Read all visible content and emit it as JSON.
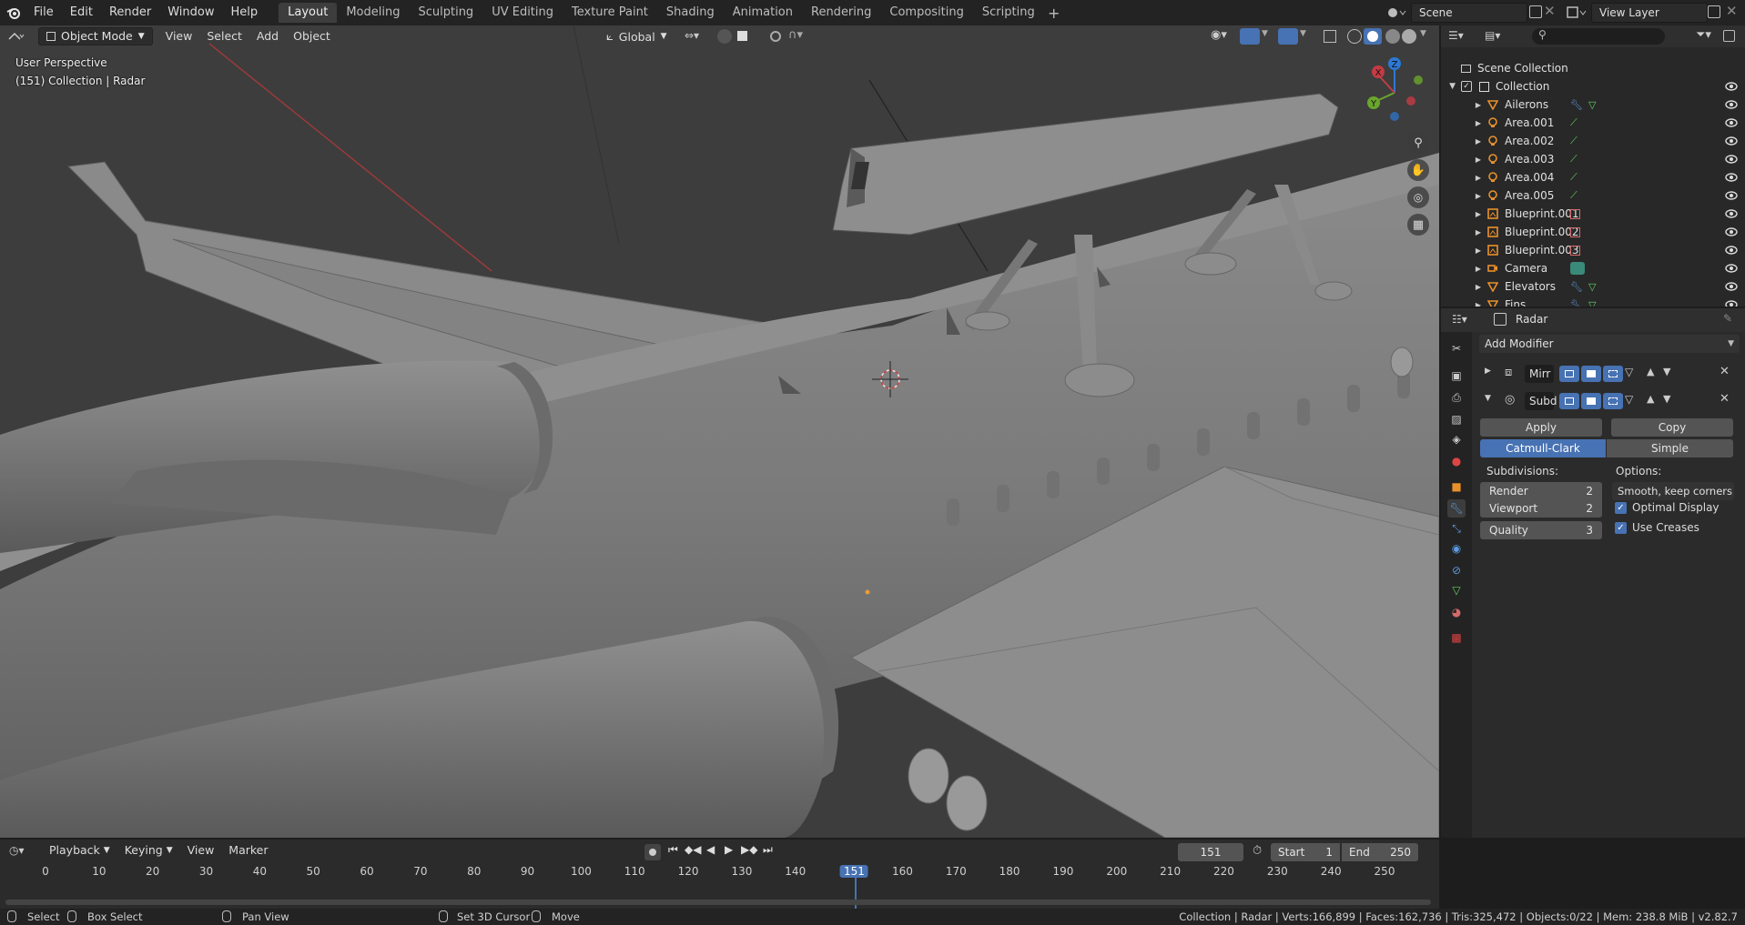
{
  "menubar": {
    "items": [
      "File",
      "Edit",
      "Render",
      "Window",
      "Help"
    ],
    "workspaces": [
      "Layout",
      "Modeling",
      "Sculpting",
      "UV Editing",
      "Texture Paint",
      "Shading",
      "Animation",
      "Rendering",
      "Compositing",
      "Scripting"
    ],
    "active_workspace": "Layout",
    "scene": "Scene",
    "view_layer": "View Layer"
  },
  "viewport": {
    "mode": "Object Mode",
    "menus": [
      "View",
      "Select",
      "Add",
      "Object"
    ],
    "transform_orientation": "Global",
    "info_line1": "User Perspective",
    "info_line2": "(151) Collection | Radar"
  },
  "outliner": {
    "search_placeholder": "",
    "root": "Scene Collection",
    "collection": "Collection",
    "items": [
      {
        "name": "Ailerons",
        "type": "mesh"
      },
      {
        "name": "Area.001",
        "type": "light"
      },
      {
        "name": "Area.002",
        "type": "light"
      },
      {
        "name": "Area.003",
        "type": "light"
      },
      {
        "name": "Area.004",
        "type": "light"
      },
      {
        "name": "Area.005",
        "type": "light"
      },
      {
        "name": "Blueprint.001",
        "type": "image"
      },
      {
        "name": "Blueprint.002",
        "type": "image"
      },
      {
        "name": "Blueprint.003",
        "type": "image"
      },
      {
        "name": "Camera",
        "type": "camera"
      },
      {
        "name": "Elevators",
        "type": "mesh"
      },
      {
        "name": "Fins",
        "type": "mesh"
      }
    ]
  },
  "properties": {
    "object_name": "Radar",
    "add_modifier": "Add Modifier",
    "modifiers": [
      {
        "name": "Mirr",
        "expanded": false
      },
      {
        "name": "Subd",
        "expanded": true
      }
    ],
    "apply_label": "Apply",
    "copy_label": "Copy",
    "catmull_label": "Catmull-Clark",
    "simple_label": "Simple",
    "subdivisions_label": "Subdivisions:",
    "options_label": "Options:",
    "render_label": "Render",
    "render_value": "2",
    "viewport_label": "Viewport",
    "viewport_value": "2",
    "quality_label": "Quality",
    "quality_value": "3",
    "uv_smooth": "Smooth, keep corners",
    "optimal_display": "Optimal Display",
    "use_creases": "Use Creases"
  },
  "timeline": {
    "menus": [
      "Playback",
      "Keying",
      "View",
      "Marker"
    ],
    "current_frame": "151",
    "start_label": "Start",
    "start_value": "1",
    "end_label": "End",
    "end_value": "250",
    "ticks": [
      "0",
      "10",
      "20",
      "30",
      "40",
      "50",
      "60",
      "70",
      "80",
      "90",
      "100",
      "110",
      "120",
      "130",
      "140",
      "151",
      "160",
      "170",
      "180",
      "190",
      "200",
      "210",
      "220",
      "230",
      "240",
      "250"
    ]
  },
  "statusbar": {
    "select": "Select",
    "box_select": "Box Select",
    "pan_view": "Pan View",
    "set_cursor": "Set 3D Cursor",
    "move": "Move",
    "stats": "Collection | Radar | Verts:166,899 | Faces:162,736 | Tris:325,472 | Objects:0/22 | Mem: 238.8 MiB | v2.82.7"
  }
}
